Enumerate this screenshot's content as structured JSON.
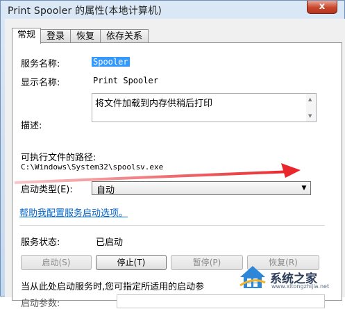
{
  "window": {
    "title": "Print Spooler 的属性(本地计算机)",
    "close_label": "x"
  },
  "tabs": [
    {
      "label": "常规"
    },
    {
      "label": "登录"
    },
    {
      "label": "恢复"
    },
    {
      "label": "依存关系"
    }
  ],
  "general": {
    "service_name_label": "服务名称:",
    "service_name_value": "Spooler",
    "display_name_label": "显示名称:",
    "display_name_value": "Print Spooler",
    "description_label": "描述:",
    "description_value": "将文件加载到内存供稍后打印",
    "exe_path_label": "可执行文件的路径:",
    "exe_path_value": "C:\\Windows\\System32\\spoolsv.exe",
    "startup_type_label": "启动类型(E):",
    "startup_type_value": "自动",
    "help_link": "帮助我配置服务启动选项。",
    "status_label": "服务状态:",
    "status_value": "已启动",
    "buttons": {
      "start": "启动(S)",
      "stop": "停止(T)",
      "pause": "暂停(P)",
      "resume": "恢复(R)"
    },
    "hint_text": "当从此处启动服务时,您可指定所适用的启动参",
    "start_params_label": "启动参数:"
  },
  "watermark": {
    "text": "系统之家",
    "subtext": "www.xitongzhijia.net"
  },
  "colors": {
    "selection": "#3399ff",
    "link": "#0066cc",
    "annotation_arrow": "#e8262c"
  }
}
